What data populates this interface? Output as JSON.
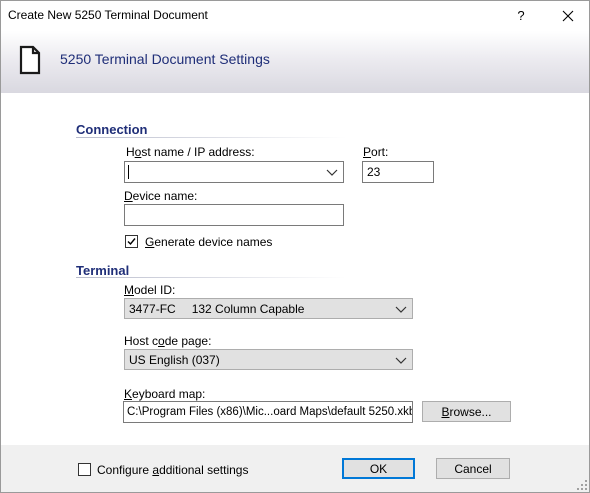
{
  "window": {
    "title": "Create New 5250 Terminal Document",
    "help_glyph": "?",
    "close_icon": "close-icon"
  },
  "banner": {
    "title": "5250 Terminal Document Settings",
    "icon": "document-icon"
  },
  "connection": {
    "heading": "Connection",
    "host_label": "Host name / IP address:",
    "host_value": "",
    "port_label": "Port:",
    "port_value": "23",
    "device_label": "Device name:",
    "device_value": "",
    "generate_label": "Generate device names",
    "generate_checked": true
  },
  "terminal": {
    "heading": "Terminal",
    "model_label": "Model ID:",
    "model_code": "3477-FC",
    "model_desc": "132 Column Capable",
    "codepage_label": "Host code page:",
    "codepage_value": "US English (037)",
    "keymap_label": "Keyboard map:",
    "keymap_value": "C:\\Program Files (x86)\\Mic...oard Maps\\default 5250.xkb",
    "browse_label": "Browse..."
  },
  "footer": {
    "configure_label": "Configure additional settings",
    "configure_checked": false,
    "ok_label": "OK",
    "cancel_label": "Cancel"
  },
  "colors": {
    "accent": "#1f2e78",
    "focus_border": "#0078d7"
  }
}
